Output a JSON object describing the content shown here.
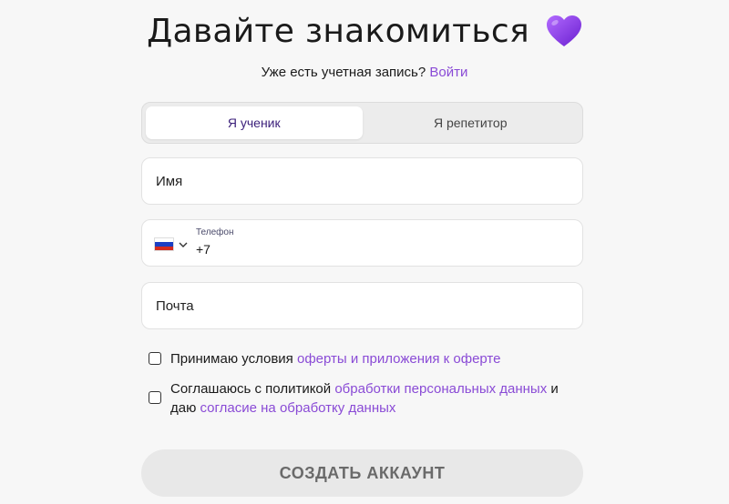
{
  "header": {
    "title": "Давайте знакомиться",
    "heart_icon": "purple-heart-icon"
  },
  "login": {
    "prompt": "Уже есть учетная запись?",
    "link": "Войти"
  },
  "tabs": [
    {
      "label": "Я ученик",
      "active": true
    },
    {
      "label": "Я репетитор",
      "active": false
    }
  ],
  "fields": {
    "name": {
      "placeholder": "Имя",
      "value": ""
    },
    "phone": {
      "label": "Телефон",
      "value": "+7",
      "country_icon": "russia-flag-icon"
    },
    "email": {
      "placeholder": "Почта",
      "value": ""
    }
  },
  "consents": {
    "offer": {
      "text": "Принимаю условия ",
      "link": "оферты и приложения к оферте",
      "checked": false
    },
    "privacy": {
      "text_before": "Соглашаюсь с политикой ",
      "link1": "обработки персональных данных",
      "text_middle": " и даю ",
      "link2": "согласие на обработку данных",
      "checked": false
    }
  },
  "submit": {
    "label": "СОЗДАТЬ АККАУНТ"
  },
  "colors": {
    "accent": "#8a4bd6",
    "active_tab_text": "#3b1f7a",
    "background": "#f7f7f7"
  }
}
